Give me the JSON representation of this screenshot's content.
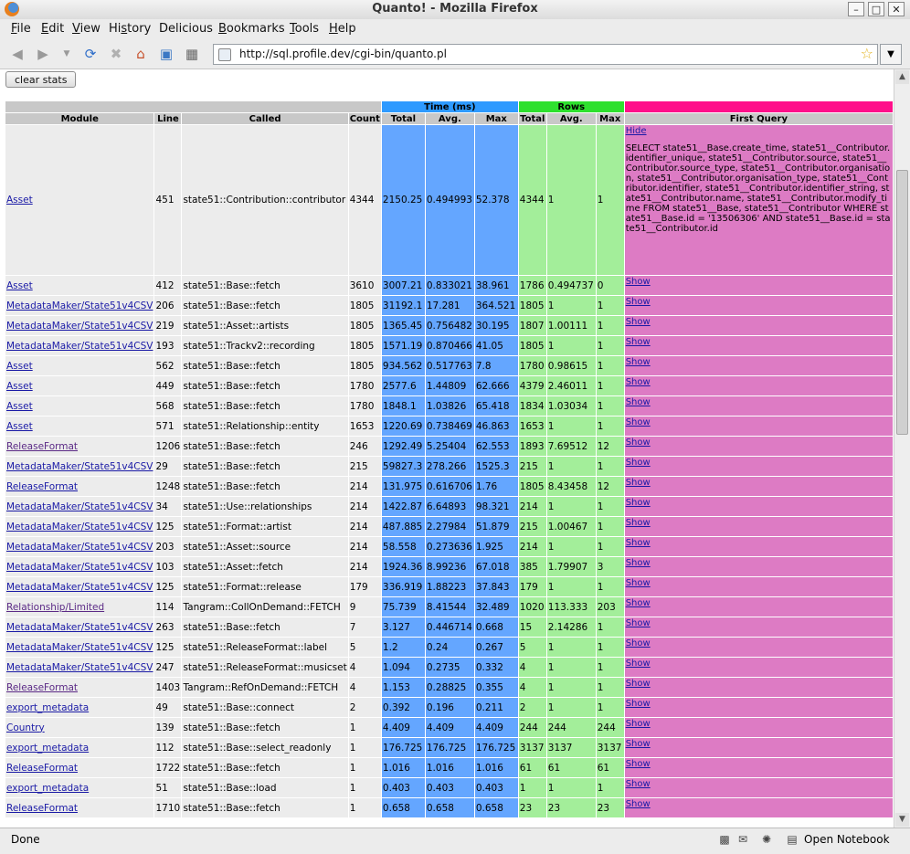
{
  "window": {
    "title": "Quanto! - Mozilla Firefox"
  },
  "menu": [
    {
      "label": "File",
      "u": "F"
    },
    {
      "label": "Edit",
      "u": "E"
    },
    {
      "label": "View",
      "u": "V"
    },
    {
      "label": "History",
      "u": "s"
    },
    {
      "label": "Delicious",
      "u": ""
    },
    {
      "label": "Bookmarks",
      "u": "B"
    },
    {
      "label": "Tools",
      "u": "T"
    },
    {
      "label": "Help",
      "u": "H"
    }
  ],
  "url": "http://sql.profile.dev/cgi-bin/quanto.pl",
  "clear_stats_label": "clear stats",
  "table": {
    "groups": {
      "time": "Time (ms)",
      "rows": "Rows",
      "first_query": "First Query"
    },
    "columns": [
      "Module",
      "Line",
      "Called",
      "Count",
      "Total",
      "Avg.",
      "Max",
      "Total",
      "Avg.",
      "Max",
      "First Query"
    ],
    "first_row_query": "SELECT state51__Base.create_time, state51__Contributor.identifier_unique, state51__Contributor.source, state51__Contributor.source_type, state51__Contributor.organisation, state51__Contributor.organisation_type, state51__Contributor.identifier, state51__Contributor.identifier_string, state51__Contributor.name, state51__Contributor.modify_time FROM state51__Base, state51__Contributor WHERE state51__Base.id = '13506306' AND state51__Base.id = state51__Contributor.id",
    "rows": [
      {
        "module": "Asset",
        "line": "451",
        "called": "state51::Contribution::contributor",
        "count": "4344",
        "tt": "2150.25",
        "ta": "0.494993",
        "tm": "52.378",
        "rt": "4344",
        "ra": "1",
        "rm": "1",
        "link": "Hide"
      },
      {
        "module": "Asset",
        "line": "412",
        "called": "state51::Base::fetch",
        "count": "3610",
        "tt": "3007.21",
        "ta": "0.833021",
        "tm": "38.961",
        "rt": "1786",
        "ra": "0.494737",
        "rm": "0",
        "link": "Show"
      },
      {
        "module": "MetadataMaker/State51v4CSV",
        "line": "206",
        "called": "state51::Base::fetch",
        "count": "1805",
        "tt": "31192.1",
        "ta": "17.281",
        "tm": "364.521",
        "rt": "1805",
        "ra": "1",
        "rm": "1",
        "link": "Show"
      },
      {
        "module": "MetadataMaker/State51v4CSV",
        "line": "219",
        "called": "state51::Asset::artists",
        "count": "1805",
        "tt": "1365.45",
        "ta": "0.756482",
        "tm": "30.195",
        "rt": "1807",
        "ra": "1.00111",
        "rm": "1",
        "link": "Show"
      },
      {
        "module": "MetadataMaker/State51v4CSV",
        "line": "193",
        "called": "state51::Trackv2::recording",
        "count": "1805",
        "tt": "1571.19",
        "ta": "0.870466",
        "tm": "41.05",
        "rt": "1805",
        "ra": "1",
        "rm": "1",
        "link": "Show"
      },
      {
        "module": "Asset",
        "line": "562",
        "called": "state51::Base::fetch",
        "count": "1805",
        "tt": "934.562",
        "ta": "0.517763",
        "tm": "7.8",
        "rt": "1780",
        "ra": "0.98615",
        "rm": "1",
        "link": "Show"
      },
      {
        "module": "Asset",
        "line": "449",
        "called": "state51::Base::fetch",
        "count": "1780",
        "tt": "2577.6",
        "ta": "1.44809",
        "tm": "62.666",
        "rt": "4379",
        "ra": "2.46011",
        "rm": "1",
        "link": "Show"
      },
      {
        "module": "Asset",
        "line": "568",
        "called": "state51::Base::fetch",
        "count": "1780",
        "tt": "1848.1",
        "ta": "1.03826",
        "tm": "65.418",
        "rt": "1834",
        "ra": "1.03034",
        "rm": "1",
        "link": "Show"
      },
      {
        "module": "Asset",
        "line": "571",
        "called": "state51::Relationship::entity",
        "count": "1653",
        "tt": "1220.69",
        "ta": "0.738469",
        "tm": "46.863",
        "rt": "1653",
        "ra": "1",
        "rm": "1",
        "link": "Show"
      },
      {
        "module": "ReleaseFormat",
        "line": "1206",
        "called": "state51::Base::fetch",
        "count": "246",
        "tt": "1292.49",
        "ta": "5.25404",
        "tm": "62.553",
        "rt": "1893",
        "ra": "7.69512",
        "rm": "12",
        "link": "Show"
      },
      {
        "module": "MetadataMaker/State51v4CSV",
        "line": "29",
        "called": "state51::Base::fetch",
        "count": "215",
        "tt": "59827.3",
        "ta": "278.266",
        "tm": "1525.3",
        "rt": "215",
        "ra": "1",
        "rm": "1",
        "link": "Show"
      },
      {
        "module": "ReleaseFormat",
        "line": "1248",
        "called": "state51::Base::fetch",
        "count": "214",
        "tt": "131.975",
        "ta": "0.616706",
        "tm": "1.76",
        "rt": "1805",
        "ra": "8.43458",
        "rm": "12",
        "link": "Show"
      },
      {
        "module": "MetadataMaker/State51v4CSV",
        "line": "34",
        "called": "state51::Use::relationships",
        "count": "214",
        "tt": "1422.87",
        "ta": "6.64893",
        "tm": "98.321",
        "rt": "214",
        "ra": "1",
        "rm": "1",
        "link": "Show"
      },
      {
        "module": "MetadataMaker/State51v4CSV",
        "line": "125",
        "called": "state51::Format::artist",
        "count": "214",
        "tt": "487.885",
        "ta": "2.27984",
        "tm": "51.879",
        "rt": "215",
        "ra": "1.00467",
        "rm": "1",
        "link": "Show"
      },
      {
        "module": "MetadataMaker/State51v4CSV",
        "line": "203",
        "called": "state51::Asset::source",
        "count": "214",
        "tt": "58.558",
        "ta": "0.273636",
        "tm": "1.925",
        "rt": "214",
        "ra": "1",
        "rm": "1",
        "link": "Show"
      },
      {
        "module": "MetadataMaker/State51v4CSV",
        "line": "103",
        "called": "state51::Asset::fetch",
        "count": "214",
        "tt": "1924.36",
        "ta": "8.99236",
        "tm": "67.018",
        "rt": "385",
        "ra": "1.79907",
        "rm": "3",
        "link": "Show"
      },
      {
        "module": "MetadataMaker/State51v4CSV",
        "line": "125",
        "called": "state51::Format::release",
        "count": "179",
        "tt": "336.919",
        "ta": "1.88223",
        "tm": "37.843",
        "rt": "179",
        "ra": "1",
        "rm": "1",
        "link": "Show"
      },
      {
        "module": "Relationship/Limited",
        "line": "114",
        "called": "Tangram::CollOnDemand::FETCH",
        "count": "9",
        "tt": "75.739",
        "ta": "8.41544",
        "tm": "32.489",
        "rt": "1020",
        "ra": "113.333",
        "rm": "203",
        "link": "Show"
      },
      {
        "module": "MetadataMaker/State51v4CSV",
        "line": "263",
        "called": "state51::Base::fetch",
        "count": "7",
        "tt": "3.127",
        "ta": "0.446714",
        "tm": "0.668",
        "rt": "15",
        "ra": "2.14286",
        "rm": "1",
        "link": "Show"
      },
      {
        "module": "MetadataMaker/State51v4CSV",
        "line": "125",
        "called": "state51::ReleaseFormat::label",
        "count": "5",
        "tt": "1.2",
        "ta": "0.24",
        "tm": "0.267",
        "rt": "5",
        "ra": "1",
        "rm": "1",
        "link": "Show"
      },
      {
        "module": "MetadataMaker/State51v4CSV",
        "line": "247",
        "called": "state51::ReleaseFormat::musicset",
        "count": "4",
        "tt": "1.094",
        "ta": "0.2735",
        "tm": "0.332",
        "rt": "4",
        "ra": "1",
        "rm": "1",
        "link": "Show"
      },
      {
        "module": "ReleaseFormat",
        "line": "1403",
        "called": "Tangram::RefOnDemand::FETCH",
        "count": "4",
        "tt": "1.153",
        "ta": "0.28825",
        "tm": "0.355",
        "rt": "4",
        "ra": "1",
        "rm": "1",
        "link": "Show"
      },
      {
        "module": "export_metadata",
        "line": "49",
        "called": "state51::Base::connect",
        "count": "2",
        "tt": "0.392",
        "ta": "0.196",
        "tm": "0.211",
        "rt": "2",
        "ra": "1",
        "rm": "1",
        "link": "Show"
      },
      {
        "module": "Country",
        "line": "139",
        "called": "state51::Base::fetch",
        "count": "1",
        "tt": "4.409",
        "ta": "4.409",
        "tm": "4.409",
        "rt": "244",
        "ra": "244",
        "rm": "244",
        "link": "Show"
      },
      {
        "module": "export_metadata",
        "line": "112",
        "called": "state51::Base::select_readonly",
        "count": "1",
        "tt": "176.725",
        "ta": "176.725",
        "tm": "176.725",
        "rt": "3137",
        "ra": "3137",
        "rm": "3137",
        "link": "Show"
      },
      {
        "module": "ReleaseFormat",
        "line": "1722",
        "called": "state51::Base::fetch",
        "count": "1",
        "tt": "1.016",
        "ta": "1.016",
        "tm": "1.016",
        "rt": "61",
        "ra": "61",
        "rm": "61",
        "link": "Show"
      },
      {
        "module": "export_metadata",
        "line": "51",
        "called": "state51::Base::load",
        "count": "1",
        "tt": "0.403",
        "ta": "0.403",
        "tm": "0.403",
        "rt": "1",
        "ra": "1",
        "rm": "1",
        "link": "Show"
      },
      {
        "module": "ReleaseFormat",
        "line": "1710",
        "called": "state51::Base::fetch",
        "count": "1",
        "tt": "0.658",
        "ta": "0.658",
        "tm": "0.658",
        "rt": "23",
        "ra": "23",
        "rm": "23",
        "link": "Show"
      }
    ]
  },
  "status": {
    "text": "Done",
    "notebook": "Open Notebook"
  },
  "colors": {
    "time_header": "#2e9aff",
    "rows_header": "#2ee02e",
    "fq_header": "#ff0f8a",
    "time_cells": "#64a6ff",
    "rows_cells": "#a3ee9a",
    "fq_cells": "#dd7bc4"
  }
}
